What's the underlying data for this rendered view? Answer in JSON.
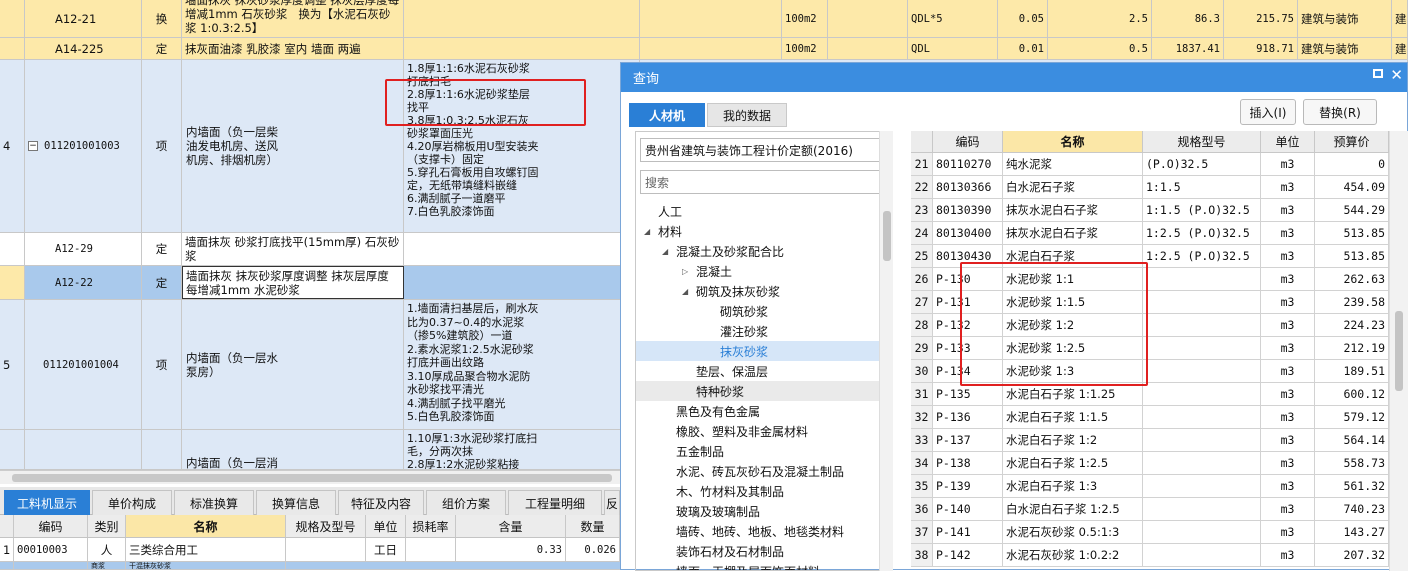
{
  "main_rows": [
    {
      "idx": "",
      "code": "A12-21",
      "type": "换",
      "name": "墙面抹灰 抹灰砂浆厚度调整 抹灰层厚度每增减1mm 石灰砂浆   换为【水泥石灰砂浆 1:0.3:2.5】",
      "desc": "",
      "unit": "100m2",
      "expr": "QDL*5",
      "qty": "0.05",
      "qty2": "2.5",
      "price": "86.3",
      "total": "215.75",
      "major": "建筑与装饰",
      "last": "建"
    },
    {
      "idx": "",
      "code": "A14-225",
      "type": "定",
      "name": "抹灰面油漆 乳胶漆 室内 墙面 两遍",
      "desc": "",
      "unit": "100m2",
      "expr": "QDL",
      "qty": "0.01",
      "qty2": "0.5",
      "price": "1837.41",
      "total": "918.71",
      "major": "建筑与装饰",
      "last": "建"
    },
    {
      "idx": "4",
      "code": "011201001003",
      "type": "项",
      "name": "内墙面（负一层柴油发电机房、送风机房、排烟机房）",
      "desc": "1.8厚1:1:6水泥石灰砂浆打底扫毛\n2.8厚1:1:6水泥砂浆垫层找平\n3.8厚1:0.3:2.5水泥石灰砂浆罩面压光\n4.20厚岩棉板用U型安装夹（支撑卡）固定\n5.穿孔石膏板用自攻螺钉固定，无纸带填缝料嵌缝\n6.满刮腻子一道磨平\n7.白色乳胶漆饰面"
    },
    {
      "idx": "",
      "code": "A12-29",
      "type": "定",
      "name": "墙面抹灰 砂浆打底找平(15mm厚) 石灰砂浆",
      "desc": ""
    },
    {
      "idx": "",
      "code": "A12-22",
      "type": "定",
      "name": "墙面抹灰 抹灰砂浆厚度调整 抹灰层厚度每增减1mm 水泥砂浆",
      "desc": ""
    },
    {
      "idx": "5",
      "code": "011201001004",
      "type": "项",
      "name": "内墙面（负一层水泵房）",
      "desc": "1.墙面清扫基层后，刷水灰比为0.37~0.4的水泥浆（掺5%建筑胶）一道\n2.素水泥浆1:2.5水泥砂浆打底并画出纹路\n3.10厚成品聚合物水泥防水砂浆找平清光\n4.满刮腻子找平磨光\n5.白色乳胶漆饰面"
    },
    {
      "idx": "",
      "code": "",
      "type": "",
      "name": "内墙面（负一层消",
      "desc": "1.10厚1:3水泥砂浆打底扫毛，分两次抹\n2.8厚1:2水泥砂浆粘接"
    }
  ],
  "bottom_tabs": [
    "工料机显示",
    "单价构成",
    "标准换算",
    "换算信息",
    "特征及内容",
    "组价方案",
    "工程量明细",
    "反"
  ],
  "bottom_headers": [
    "编码",
    "类别",
    "名称",
    "规格及型号",
    "单位",
    "损耗率",
    "含量",
    "数量"
  ],
  "bottom_rows": [
    {
      "idx": "1",
      "code": "00010003",
      "cat": "人",
      "name": "三类综合用工",
      "spec": "",
      "unit": "工日",
      "loss": "",
      "content": "0.33",
      "qty": "0.026"
    },
    {
      "idx": "2",
      "code": "",
      "cat": "商浆",
      "name": "干混抹灰砂浆",
      "spec": "",
      "unit": "",
      "loss": "",
      "content": "",
      "qty": ""
    }
  ],
  "dialog": {
    "title": "查询",
    "tabs": [
      "人材机",
      "我的数据"
    ],
    "insert_label": "插入(I)",
    "replace_label": "替换(R)",
    "quota_select": "贵州省建筑与装饰工程计价定额(2016)",
    "search_placeholder": "搜索",
    "tree": [
      {
        "label": "人工",
        "level": 0,
        "arrow": "",
        "sel": false
      },
      {
        "label": "材料",
        "level": 0,
        "arrow": "◢",
        "sel": false
      },
      {
        "label": "混凝土及砂浆配合比",
        "level": 1,
        "arrow": "◢",
        "sel": false
      },
      {
        "label": "混凝土",
        "level": 2,
        "arrow": "▷",
        "sel": false
      },
      {
        "label": "砌筑及抹灰砂浆",
        "level": 2,
        "arrow": "◢",
        "sel": false
      },
      {
        "label": "砌筑砂浆",
        "level": 3,
        "arrow": "",
        "sel": false
      },
      {
        "label": "灌注砂浆",
        "level": 3,
        "arrow": "",
        "sel": false
      },
      {
        "label": "抹灰砂浆",
        "level": 3,
        "arrow": "",
        "sel": true
      },
      {
        "label": "垫层、保温层",
        "level": 2,
        "arrow": "",
        "sel": false
      },
      {
        "label": "特种砂浆",
        "level": 2,
        "arrow": "",
        "sel": false
      },
      {
        "label": "黑色及有色金属",
        "level": 1,
        "arrow": "",
        "sel": false
      },
      {
        "label": "橡胶、塑料及非金属材料",
        "level": 1,
        "arrow": "",
        "sel": false
      },
      {
        "label": "五金制品",
        "level": 1,
        "arrow": "",
        "sel": false
      },
      {
        "label": "水泥、砖瓦灰砂石及混凝土制品",
        "level": 1,
        "arrow": "",
        "sel": false
      },
      {
        "label": "木、竹材料及其制品",
        "level": 1,
        "arrow": "",
        "sel": false
      },
      {
        "label": "玻璃及玻璃制品",
        "level": 1,
        "arrow": "",
        "sel": false
      },
      {
        "label": "墙砖、地砖、地板、地毯类材料",
        "level": 1,
        "arrow": "",
        "sel": false
      },
      {
        "label": "装饰石材及石材制品",
        "level": 1,
        "arrow": "",
        "sel": false
      },
      {
        "label": "墙面、天棚及屋面饰面材料",
        "level": 1,
        "arrow": "",
        "sel": false
      }
    ],
    "grid_headers": [
      "编码",
      "名称",
      "规格型号",
      "单位",
      "预算价"
    ],
    "grid_rows": [
      {
        "n": "21",
        "code": "80110270",
        "name": "纯水泥浆",
        "spec": "(P.O)32.5",
        "unit": "m3",
        "price": "0"
      },
      {
        "n": "22",
        "code": "80130366",
        "name": "白水泥石子浆",
        "spec": "1:1.5",
        "unit": "m3",
        "price": "454.09"
      },
      {
        "n": "23",
        "code": "80130390",
        "name": "抹灰水泥白石子浆",
        "spec": "1:1.5 (P.O)32.5",
        "unit": "m3",
        "price": "544.29"
      },
      {
        "n": "24",
        "code": "80130400",
        "name": "抹灰水泥白石子浆",
        "spec": "1:2.5 (P.O)32.5",
        "unit": "m3",
        "price": "513.85"
      },
      {
        "n": "25",
        "code": "80130430",
        "name": "水泥白石子浆",
        "spec": "1:2.5 (P.O)32.5",
        "unit": "m3",
        "price": "513.85"
      },
      {
        "n": "26",
        "code": "P-130",
        "name": "水泥砂浆 1:1",
        "spec": "",
        "unit": "m3",
        "price": "262.63"
      },
      {
        "n": "27",
        "code": "P-131",
        "name": "水泥砂浆 1:1.5",
        "spec": "",
        "unit": "m3",
        "price": "239.58"
      },
      {
        "n": "28",
        "code": "P-132",
        "name": "水泥砂浆 1:2",
        "spec": "",
        "unit": "m3",
        "price": "224.23"
      },
      {
        "n": "29",
        "code": "P-133",
        "name": "水泥砂浆 1:2.5",
        "spec": "",
        "unit": "m3",
        "price": "212.19"
      },
      {
        "n": "30",
        "code": "P-134",
        "name": "水泥砂浆 1:3",
        "spec": "",
        "unit": "m3",
        "price": "189.51"
      },
      {
        "n": "31",
        "code": "P-135",
        "name": "水泥白石子浆 1:1.25",
        "spec": "",
        "unit": "m3",
        "price": "600.12"
      },
      {
        "n": "32",
        "code": "P-136",
        "name": "水泥白石子浆 1:1.5",
        "spec": "",
        "unit": "m3",
        "price": "579.12"
      },
      {
        "n": "33",
        "code": "P-137",
        "name": "水泥白石子浆 1:2",
        "spec": "",
        "unit": "m3",
        "price": "564.14"
      },
      {
        "n": "34",
        "code": "P-138",
        "name": "水泥白石子浆 1:2.5",
        "spec": "",
        "unit": "m3",
        "price": "558.73"
      },
      {
        "n": "35",
        "code": "P-139",
        "name": "水泥白石子浆 1:3",
        "spec": "",
        "unit": "m3",
        "price": "561.32"
      },
      {
        "n": "36",
        "code": "P-140",
        "name": "白水泥白石子浆 1:2.5",
        "spec": "",
        "unit": "m3",
        "price": "740.23"
      },
      {
        "n": "37",
        "code": "P-141",
        "name": "水泥石灰砂浆 0.5:1:3",
        "spec": "",
        "unit": "m3",
        "price": "143.27"
      },
      {
        "n": "38",
        "code": "P-142",
        "name": "水泥石灰砂浆 1:0.2:2",
        "spec": "",
        "unit": "m3",
        "price": "207.32"
      }
    ]
  },
  "colors": {
    "accent": "#2a7fd6",
    "dialog_title": "#3b8de0",
    "highlight_box": "#e02020",
    "yellow_row": "#fde9a9",
    "blue_row": "#dde8f6"
  }
}
